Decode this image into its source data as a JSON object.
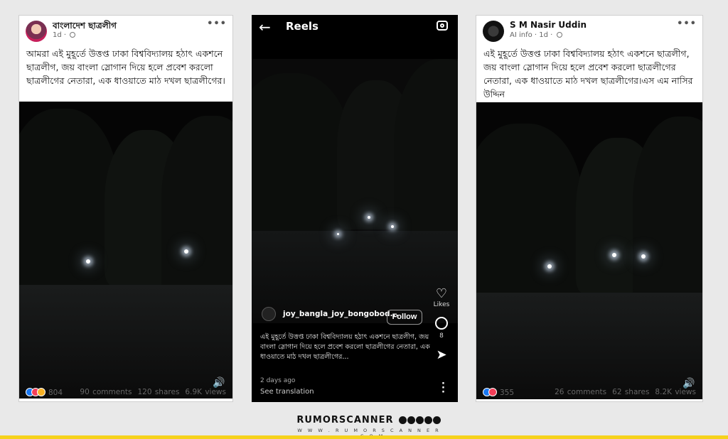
{
  "post1": {
    "page_name": "বাংলাদেশ ছাত্রলীগ",
    "time": "1d · ",
    "more": "•••",
    "text": "আমরা এই মুহূর্তে উত্তপ্ত ঢাকা বিশ্ববিদ্যালয় হঠাৎ একশনে ছাত্রলীগ, জয় বাংলা স্লোগান দিয়ে হলে প্রবেশ করলো ছাত্রলীগের নেতারা, এক ধাওয়াতে মাঠ দখল ছাত্রলীগের।",
    "reaction_count": "804",
    "comments": "90 comments",
    "shares": "120 shares",
    "views": "6.9K views"
  },
  "reel": {
    "title": "Reels",
    "username": "joy_bangla_joy_bongobod...",
    "follow_label": "Follow",
    "likes_label": "Likes",
    "comments_count": "8",
    "caption": "এই মুহূর্তে উত্তপ্ত ঢাকা বিশ্ববিদ্যালয় হঠাৎ একশনে ছাত্রলীগ, জয় বাংলা স্লোগান দিয়ে হলে প্রবেশ করলো ছাত্রলীগের নেতারা, এক ধাওয়াতে মাঠ দখল ছাত্রলীগের...",
    "time_ago": "2 days ago",
    "see_translation": "See translation"
  },
  "post3": {
    "page_name": "S M Nasir Uddin",
    "time": "AI info · 1d · ",
    "more": "•••",
    "text": "এই মুহূর্তে উত্তপ্ত ঢাকা বিশ্ববিদ্যালয় হঠাৎ একশনে ছাত্রলীগ, জয় বাংলা স্লোগান দিয়ে হলে প্রবেশ করলো ছাত্রলীগের নেতারা, এক ধাওয়াতে মাঠ দখল ছাত্রলীগের।এস এম নাসির উদ্দিন",
    "reaction_count": "355",
    "comments": "26 comments",
    "shares": "62 shares",
    "views": "8.2K views"
  },
  "brand": {
    "name": "RUMORSCANNER",
    "url": "W W W . R U M O R S C A N N E R . C O M"
  },
  "colors": {
    "accent_bar": "#f5d21b",
    "fb_like": "#1877f2",
    "fb_love": "#f33e58"
  }
}
